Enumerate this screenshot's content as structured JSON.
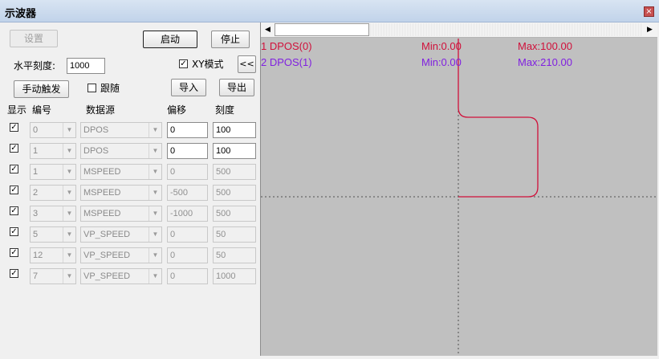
{
  "window": {
    "title": "示波器",
    "close": "×"
  },
  "toolbar": {
    "settings": "设置",
    "start": "启动",
    "stop": "停止",
    "hscale_label": "水平刻度:",
    "hscale_value": "1000",
    "xy_mode": "XY模式",
    "collapse": "<<",
    "manual_trigger": "手动触发",
    "follow": "跟随",
    "import": "导入",
    "export": "导出"
  },
  "table": {
    "headers": {
      "show": "显示",
      "id": "编号",
      "source": "数据源",
      "offset": "偏移",
      "scale": "刻度"
    },
    "rows": [
      {
        "checked": "✓",
        "id": "0",
        "source": "DPOS",
        "offset": "0",
        "scale": "100"
      },
      {
        "checked": "✓",
        "id": "1",
        "source": "DPOS",
        "offset": "0",
        "scale": "100"
      },
      {
        "checked": "✓",
        "id": "1",
        "source": "MSPEED",
        "offset": "0",
        "scale": "500"
      },
      {
        "checked": "✓",
        "id": "2",
        "source": "MSPEED",
        "offset": "-500",
        "scale": "500"
      },
      {
        "checked": "✓",
        "id": "3",
        "source": "MSPEED",
        "offset": "-1000",
        "scale": "500"
      },
      {
        "checked": "✓",
        "id": "5",
        "source": "VP_SPEED",
        "offset": "0",
        "scale": "50"
      },
      {
        "checked": "✓",
        "id": "12",
        "source": "VP_SPEED",
        "offset": "0",
        "scale": "50"
      },
      {
        "checked": "✓",
        "id": "7",
        "source": "VP_SPEED",
        "offset": "0",
        "scale": "1000"
      }
    ]
  },
  "scope": {
    "channels": [
      {
        "name": "1 DPOS(0)",
        "min": "Min:0.00",
        "max": "Max:100.00",
        "color": "#d0103a"
      },
      {
        "name": "2 DPOS(1)",
        "min": "Min:0.00",
        "max": "Max:210.00",
        "color": "#8020e0"
      }
    ],
    "trace_color": "#d0103a"
  }
}
